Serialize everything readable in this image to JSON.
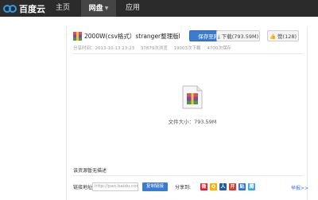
{
  "nav": {
    "logo_text": "百度云",
    "items": [
      {
        "label": "主页",
        "active": false
      },
      {
        "label": "网盘",
        "active": true
      },
      {
        "label": "应用",
        "active": false
      }
    ]
  },
  "file": {
    "title": "2000W(csv格式）stranger整理版lesit...",
    "buttons": {
      "save": "保存至网盘",
      "download": "下载(793.59M)",
      "like": "赞(128)"
    },
    "meta": {
      "share_time": "分享时间：2013-10-13 23:23",
      "views": "37879次浏览",
      "downloads": "19003次下载",
      "saves": "4700次保存"
    },
    "size_text": "文件大小：793.59M"
  },
  "description_label": "该资源暂无描述",
  "share": {
    "link_label": "链接地址:",
    "link_value": "http://pan.baidu.com/s/",
    "copy_button": "复制链接",
    "share_label": "分享到:",
    "report_link": "举报>>",
    "icons": [
      {
        "name": "sina-weibo-icon",
        "glyph": "微",
        "color": "#e6162d"
      },
      {
        "name": "qzone-icon",
        "glyph": "Q",
        "color": "#f6b400"
      },
      {
        "name": "renren-icon",
        "glyph": "人",
        "color": "#1d5ba6"
      },
      {
        "name": "kaixin-icon",
        "glyph": "开",
        "color": "#d4392b"
      },
      {
        "name": "tieba-icon",
        "glyph": "贴",
        "color": "#2a6fd6"
      },
      {
        "name": "tencent-weibo-icon",
        "glyph": "腾",
        "color": "#3ba7d9"
      }
    ]
  },
  "colors": {
    "topbar": "#2b2b2b",
    "accent": "#3b7bd0"
  }
}
